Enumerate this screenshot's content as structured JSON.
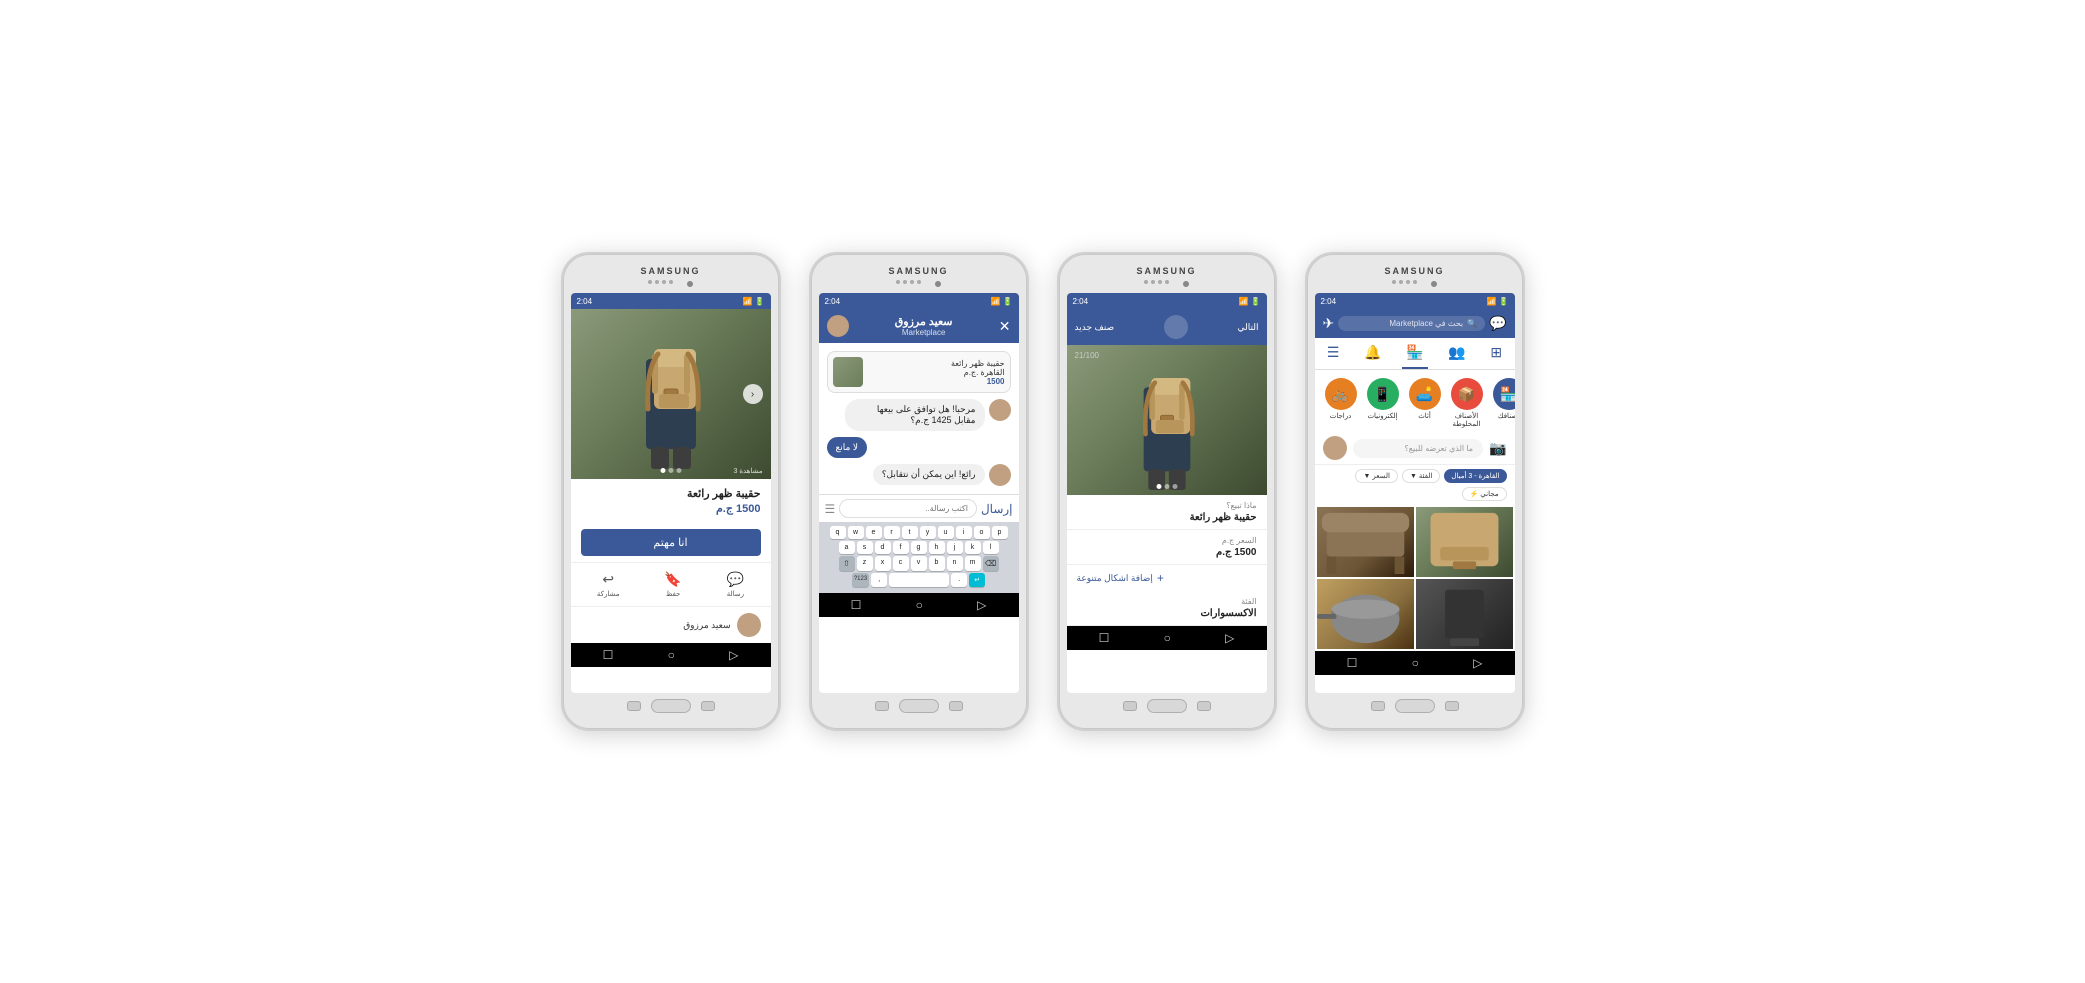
{
  "phones": [
    {
      "id": "phone1",
      "brand": "SAMSUNG",
      "status_time": "2:04",
      "screen": {
        "type": "product_detail",
        "product_image_alt": "backpack on person",
        "dots_count": 3,
        "views": "3 مشاهدة",
        "title": "حقيبة ظهر رائعة",
        "price": "1500 ج.م",
        "interested_btn": "انا مهتم",
        "actions": [
          {
            "label": "رسالة",
            "icon": "💬"
          },
          {
            "label": "حفظ",
            "icon": "🔖"
          },
          {
            "label": "مشاركة",
            "icon": "↩"
          }
        ],
        "seller_name": "سعيد مرزوق"
      }
    },
    {
      "id": "phone2",
      "brand": "SAMSUNG",
      "status_time": "2:04",
      "screen": {
        "type": "messenger",
        "header_title": "سعيد مرزوق",
        "header_subtitle": "Marketplace",
        "product_preview": {
          "title": "حقيبة ظهر رائعة",
          "location": "القاهرة .ج.م",
          "price": "1500"
        },
        "messages": [
          {
            "type": "received",
            "text": "مرحبا! هل توافق على بيعها مقابل 1425 ج.م؟",
            "has_avatar": true
          },
          {
            "type": "sent",
            "text": "لا مانع",
            "bubble_class": "blue"
          },
          {
            "type": "received",
            "text": "رائع! اين يمكن أن نتقابل؟",
            "has_avatar": true
          }
        ],
        "input_placeholder": "اكتب رسالة..",
        "send_btn": "إرسال",
        "keyboard_rows": [
          [
            "q",
            "w",
            "e",
            "r",
            "t",
            "y",
            "u",
            "i",
            "o",
            "p"
          ],
          [
            "a",
            "s",
            "d",
            "f",
            "g",
            "h",
            "j",
            "k",
            "l"
          ],
          [
            "⇧",
            "z",
            "x",
            "c",
            "v",
            "b",
            "n",
            "m",
            "⌫"
          ],
          [
            "?123",
            ",",
            " ",
            ".",
            "↵"
          ]
        ]
      }
    },
    {
      "id": "phone3",
      "brand": "SAMSUNG",
      "status_time": "2:04",
      "screen": {
        "type": "listing_form",
        "header_back": "التالي",
        "header_next": "صنف جديد",
        "char_count": "21/100",
        "fields": [
          {
            "label": "ماذا تبيع؟",
            "value": "حقيبة ظهر رائعة"
          },
          {
            "label": "السعر ج.م",
            "value": "1500 ج.م"
          },
          {
            "label": "إضافة اشكال متنوعة",
            "type": "add"
          },
          {
            "label": "الفئة",
            "value": "الاكسسوارات"
          }
        ]
      }
    },
    {
      "id": "phone4",
      "brand": "SAMSUNG",
      "status_time": "2:04",
      "screen": {
        "type": "marketplace_browse",
        "header": {
          "search_placeholder": "بحث في Marketplace",
          "title": "Marketplace",
          "messenger_icon": "💬",
          "send_icon": "✈"
        },
        "categories": [
          {
            "label": "أصنافك",
            "icon": "🏪",
            "color": "#3b5998"
          },
          {
            "label": "الأصناف المحلوطة",
            "icon": "📦",
            "color": "#e74c3c"
          },
          {
            "label": "أثاث",
            "icon": "🛋️",
            "color": "#e67e22"
          },
          {
            "label": "إلكترونيات",
            "icon": "📱",
            "color": "#27ae60"
          },
          {
            "label": "دراجات",
            "icon": "🚲",
            "color": "#e67e22"
          }
        ],
        "sell_placeholder": "ما الذي تعرضه للبيع؟",
        "filters": [
          {
            "label": "القاهرة - 3 أميال",
            "active": true
          },
          {
            "label": "الفئة",
            "icon": "▼",
            "active": false
          },
          {
            "label": "السعر",
            "icon": "▼",
            "active": false
          },
          {
            "label": "مجاني ⚡",
            "active": false
          }
        ]
      }
    }
  ]
}
